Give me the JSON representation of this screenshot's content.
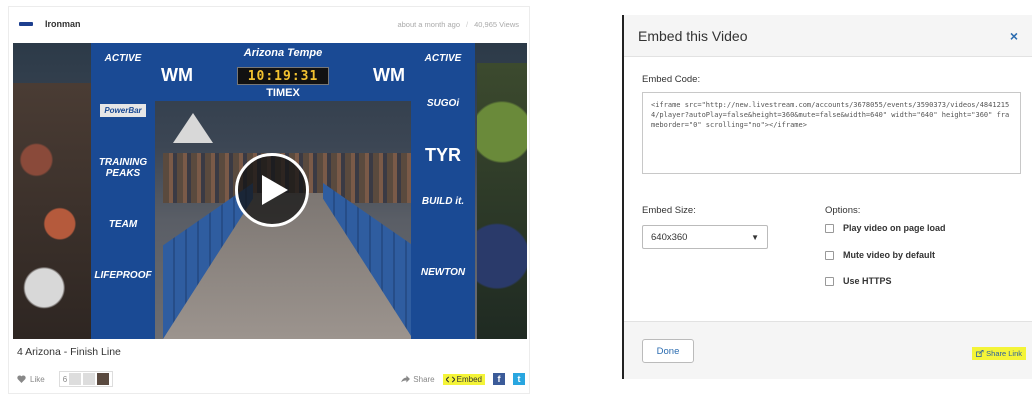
{
  "video_card": {
    "channel_name": "Ironman",
    "posted": "about a month ago",
    "separator": "/",
    "views": "40,965 Views",
    "title": "4 Arizona - Finish Line",
    "like_label": "Like",
    "like_count": "6",
    "share_label": "Share",
    "embed_label": "Embed",
    "facebook_glyph": "f",
    "twitter_glyph": "t"
  },
  "player_scene": {
    "arch_brand": "Arizona",
    "arch_brand_suffix": "Tempe",
    "clock": "10:19:31",
    "timex": "TIMEX",
    "wm_left": "WM",
    "wm_right": "WM",
    "left_pillar": [
      "ACTIVE",
      "PowerBar",
      "TRAINING PEAKS",
      "TEAM",
      "LIFEPROOF"
    ],
    "right_pillar": [
      "ACTIVE",
      "SUGOi",
      "TYR",
      "BUILD it.",
      "NEWTON"
    ]
  },
  "embed_modal": {
    "title": "Embed this Video",
    "close_glyph": "×",
    "code_label": "Embed Code:",
    "code": "<iframe src=\"http://new.livestream.com/accounts/3678055/events/3590373/videos/48412154/player?autoPlay=false&height=360&mute=false&width=640\" width=\"640\" height=\"360\" frameborder=\"0\" scrolling=\"no\"></iframe>",
    "size_label": "Embed Size:",
    "size_value": "640x360",
    "options_label": "Options:",
    "options": [
      "Play video on page load",
      "Mute video by default",
      "Use HTTPS"
    ],
    "done_label": "Done",
    "share_link_label": "Share Link"
  },
  "colors": {
    "highlight": "#f4f438",
    "link_blue": "#2b6cb0",
    "banner_blue": "#1a4a94"
  },
  "icons": {
    "play": "play-icon",
    "heart": "heart-icon",
    "share": "share-arrow-icon",
    "embed": "embed-code-icon",
    "close": "close-icon",
    "share_link": "external-link-icon"
  }
}
